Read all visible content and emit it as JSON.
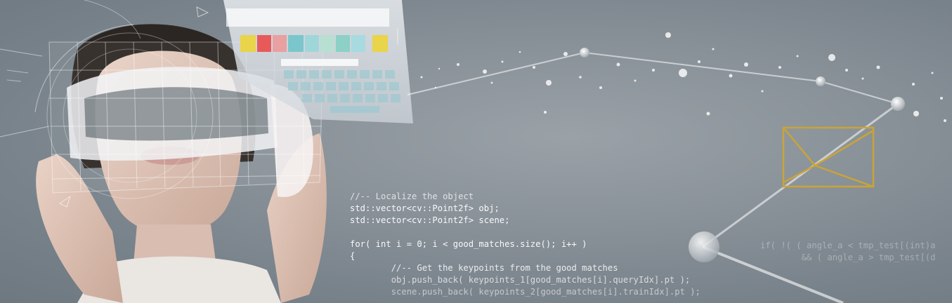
{
  "hero": {
    "code_lines": [
      "//-- Localize the object",
      "std::vector<cv::Point2f> obj;",
      "std::vector<cv::Point2f> scene;",
      "",
      "for( int i = 0; i < good_matches.size(); i++ )",
      "{",
      "        //-- Get the keypoints from the good matches",
      "        obj.push_back( keypoints_1[good_matches[i].queryIdx].pt );",
      "        scene.push_back( keypoints_2[good_matches[i].trainIdx].pt );"
    ],
    "side_code_lines": [
      "if( !( ( angle_a < tmp_test[(int)a",
      "        && ( angle_a > tmp_test[(d"
    ]
  },
  "colors": {
    "background": "#8b939a",
    "wireframe": "#c9a437",
    "hud_line": "#ffffff"
  }
}
